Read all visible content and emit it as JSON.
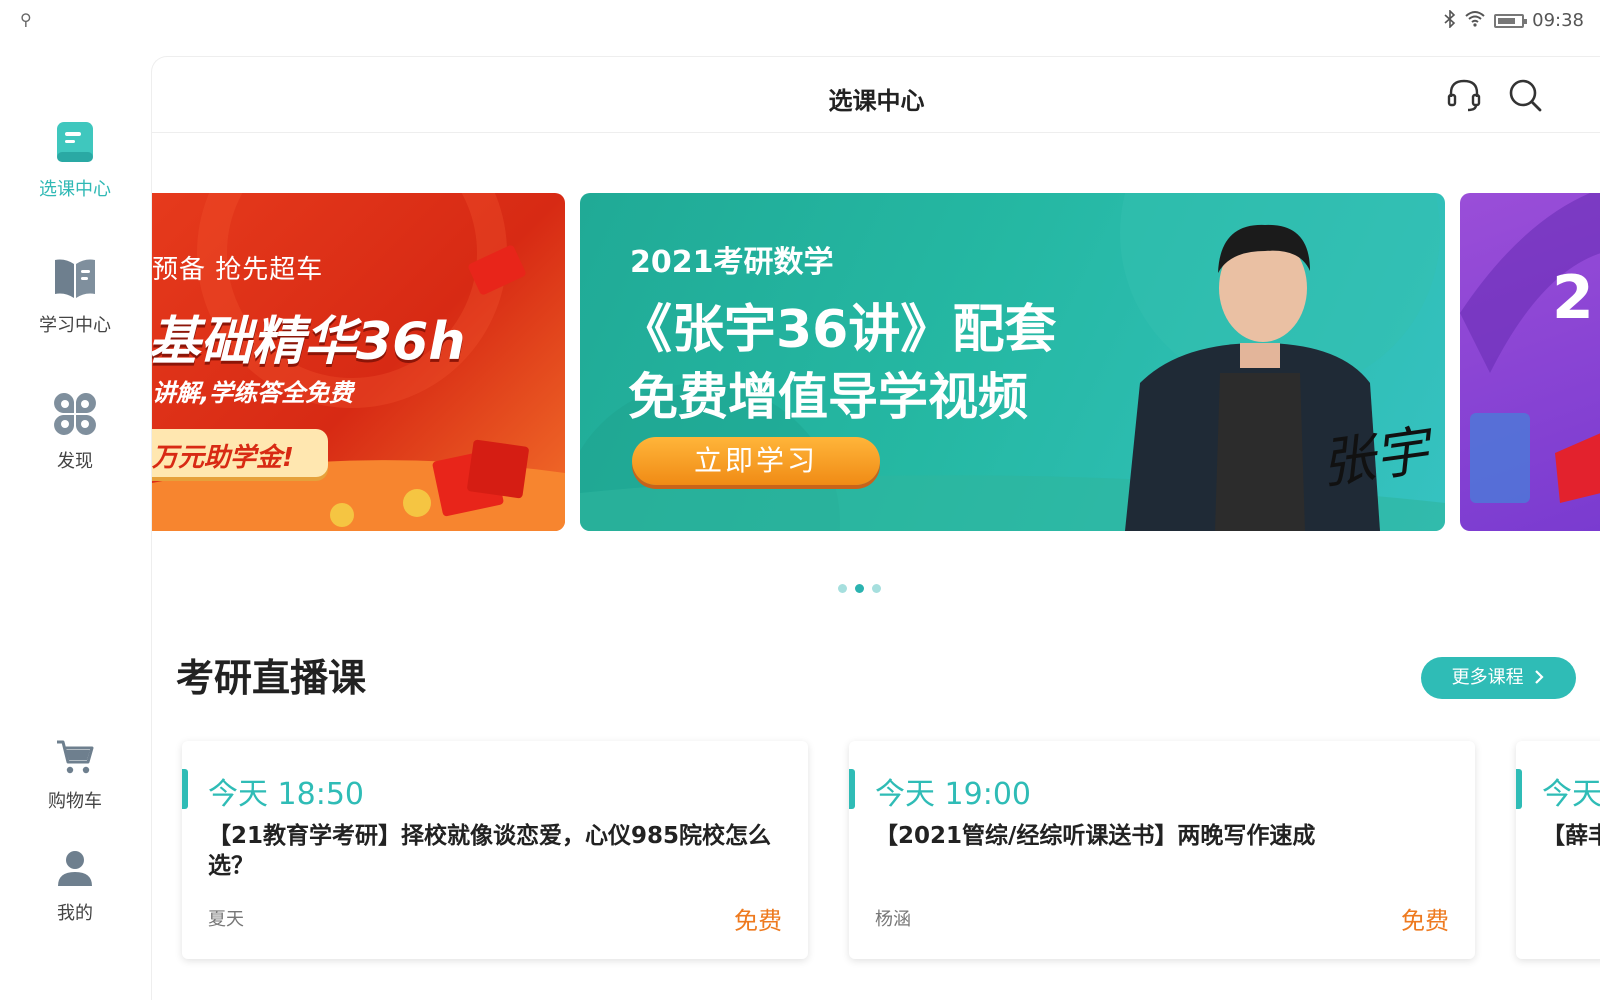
{
  "status_bar": {
    "usb_glyph": "⚲",
    "time": "09:38"
  },
  "nav": {
    "items": [
      {
        "label": "选课中心"
      },
      {
        "label": "学习中心"
      },
      {
        "label": "发现"
      },
      {
        "label": "购物车"
      },
      {
        "label": "我的"
      }
    ]
  },
  "header": {
    "title": "选课中心"
  },
  "banners": [
    {
      "line1": "预备 抢先超车",
      "line2": "基础精华36h",
      "line3": "讲解,学练答全免费",
      "line4": "万元助学金!"
    },
    {
      "line1": "2021考研数学",
      "line2": "《张宇36讲》配套",
      "line3": "免费增值导学视频",
      "button": "立即学习",
      "signature": "张宇"
    },
    {
      "partial": "2"
    }
  ],
  "carousel": {
    "total": 3,
    "active_index": 1
  },
  "section": {
    "title": "考研直播课",
    "more_button": "更多课程"
  },
  "courses": [
    {
      "time": "今天 18:50",
      "title": "【21教育学考研】择校就像谈恋爱，心仪985院校怎么选？",
      "teacher": "夏天",
      "price": "免费"
    },
    {
      "time": "今天 19:00",
      "title": "【2021管综/经综听课送书】两晚写作速成",
      "teacher": "杨涵",
      "price": "免费"
    },
    {
      "time": "今天",
      "title": "【薛丰 作）",
      "teacher": "",
      "price": ""
    }
  ],
  "colors": {
    "accent": "#2fbcb6",
    "price": "#ee7a1f"
  }
}
